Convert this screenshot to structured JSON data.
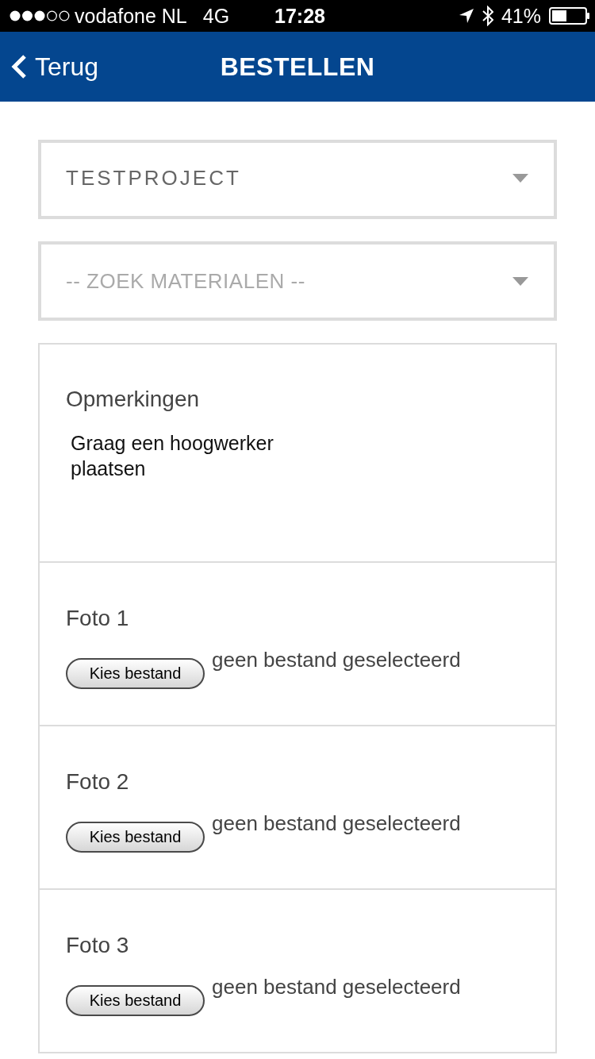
{
  "status_bar": {
    "carrier": "vodafone NL",
    "network": "4G",
    "time": "17:28",
    "battery": "41%"
  },
  "nav_bar": {
    "back_label": "Terug",
    "title": "BESTELLEN"
  },
  "project_select": {
    "value": "TESTPROJECT"
  },
  "material_select": {
    "placeholder": "-- ZOEK MATERIALEN --"
  },
  "remarks": {
    "label": "Opmerkingen",
    "value": "Graag een hoogwerker plaatsen"
  },
  "photos": [
    {
      "label": "Foto 1",
      "button": "Kies bestand",
      "status": "geen bestand geselecteerd"
    },
    {
      "label": "Foto 2",
      "button": "Kies bestand",
      "status": "geen bestand geselecteerd"
    },
    {
      "label": "Foto 3",
      "button": "Kies bestand",
      "status": "geen bestand geselecteerd"
    }
  ]
}
